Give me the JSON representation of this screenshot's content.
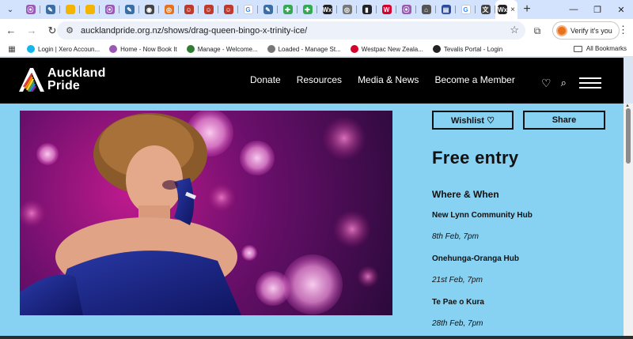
{
  "browser": {
    "tabs": [
      {
        "icon": "pride-icon",
        "color": "#9b59b6",
        "glyph": "⦿"
      },
      {
        "icon": "pen-icon",
        "color": "#3a6ea5",
        "glyph": "✎"
      },
      {
        "icon": "slides-icon",
        "color": "#f4b400",
        "glyph": ""
      },
      {
        "icon": "slides-icon",
        "color": "#f4b400",
        "glyph": ""
      },
      {
        "icon": "pride-icon",
        "color": "#9b59b6",
        "glyph": "⦿"
      },
      {
        "icon": "pen-icon",
        "color": "#3a6ea5",
        "glyph": "✎"
      },
      {
        "icon": "chrome-icon",
        "color": "#444444",
        "glyph": "◉"
      },
      {
        "icon": "compass-icon",
        "color": "#e8711a",
        "glyph": "◎"
      },
      {
        "icon": "face-icon",
        "color": "#c0392b",
        "glyph": "☺"
      },
      {
        "icon": "face-icon",
        "color": "#c0392b",
        "glyph": "☺"
      },
      {
        "icon": "face-icon",
        "color": "#c0392b",
        "glyph": "☺"
      },
      {
        "icon": "google-icon",
        "color": "#ffffff",
        "glyph": "G"
      },
      {
        "icon": "pen-icon",
        "color": "#3a6ea5",
        "glyph": "✎"
      },
      {
        "icon": "pinwheel-icon",
        "color": "#34a853",
        "glyph": "✚"
      },
      {
        "icon": "pinwheel-icon",
        "color": "#34a853",
        "glyph": "✚"
      },
      {
        "icon": "wix-icon",
        "color": "#222222",
        "glyph": "Wx"
      },
      {
        "icon": "loader-icon",
        "color": "#777777",
        "glyph": "◎"
      },
      {
        "icon": "tevalis-icon",
        "color": "#222222",
        "glyph": "▮"
      },
      {
        "icon": "westpac-icon",
        "color": "#d5002b",
        "glyph": "W"
      },
      {
        "icon": "pride-icon",
        "color": "#9b59b6",
        "glyph": "⦿"
      },
      {
        "icon": "bank-icon",
        "color": "#555555",
        "glyph": "⌂"
      },
      {
        "icon": "flag-icon",
        "color": "#2b4c9b",
        "glyph": "▤"
      },
      {
        "icon": "google-icon",
        "color": "#ffffff",
        "glyph": "G"
      },
      {
        "icon": "translate-icon",
        "color": "#444444",
        "glyph": "文"
      },
      {
        "icon": "wix-icon",
        "color": "#222222",
        "glyph": "Wx"
      }
    ],
    "active_tab_close": "×",
    "new_tab": "+",
    "url": "aucklandpride.org.nz/shows/drag-queen-bingo-x-trinity-ice/",
    "profile_label": "Verify it's you",
    "bookmarks": [
      {
        "label": "Login | Xero Accoun...",
        "icon": "xero-icon",
        "color": "#13b5ea"
      },
      {
        "label": "Home - Now Book It",
        "icon": "pride-icon",
        "color": "#9b59b6"
      },
      {
        "label": "Manage - Welcome...",
        "icon": "manage-icon",
        "color": "#2e7d32"
      },
      {
        "label": "Loaded - Manage St...",
        "icon": "loader-icon",
        "color": "#777777"
      },
      {
        "label": "Westpac New Zeala...",
        "icon": "westpac-icon",
        "color": "#d5002b"
      },
      {
        "label": "Tevalis Portal - Login",
        "icon": "tevalis-icon",
        "color": "#222222"
      }
    ],
    "all_bookmarks_label": "All Bookmarks"
  },
  "site": {
    "logo_line1": "Auckland",
    "logo_line2": "Pride",
    "nav": [
      "Donate",
      "Resources",
      "Media & News",
      "Become a Member"
    ]
  },
  "event": {
    "wishlist_label": "Wishlist ♡",
    "share_label": "Share",
    "price": "Free entry",
    "where_when_heading": "Where & When",
    "sessions": [
      {
        "venue": "New Lynn Community Hub",
        "date": "8th Feb, 7pm"
      },
      {
        "venue": "Onehunga-Oranga Hub",
        "date": "21st Feb, 7pm"
      },
      {
        "venue": "Te Pae o Kura",
        "date": "28th Feb, 7pm"
      }
    ]
  },
  "colors": {
    "page_bg": "#87d1f2",
    "header_bg": "#000000",
    "text": "#111111"
  }
}
